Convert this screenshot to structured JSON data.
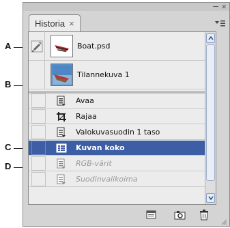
{
  "callouts": {
    "a": "A",
    "b": "B",
    "c": "C",
    "d": "D"
  },
  "panel": {
    "tab_label": "Historia",
    "tab_close": "×",
    "window_close": "×",
    "window_minimize": "–",
    "menu_icon": "▾≡"
  },
  "snapshots": [
    {
      "label": "Boat.psd",
      "icon": "history-brush-icon"
    },
    {
      "label": "Tilannekuva 1",
      "icon": ""
    }
  ],
  "steps": [
    {
      "label": "Avaa",
      "icon": "document-icon",
      "state": "normal"
    },
    {
      "label": "Rajaa",
      "icon": "crop-icon",
      "state": "normal"
    },
    {
      "label": "Valokuvasuodin 1 taso",
      "icon": "document-icon",
      "state": "normal"
    },
    {
      "label": "Kuvan koko",
      "icon": "image-size-icon",
      "state": "selected"
    },
    {
      "label": "RGB-värit",
      "icon": "document-icon",
      "state": "disabled"
    },
    {
      "label": "Suodinvalikoima",
      "icon": "document-icon",
      "state": "disabled"
    }
  ],
  "colors": {
    "selected": "#3d5ea4",
    "panel_bg": "#d4d4d4",
    "list_bg": "#ececec"
  }
}
